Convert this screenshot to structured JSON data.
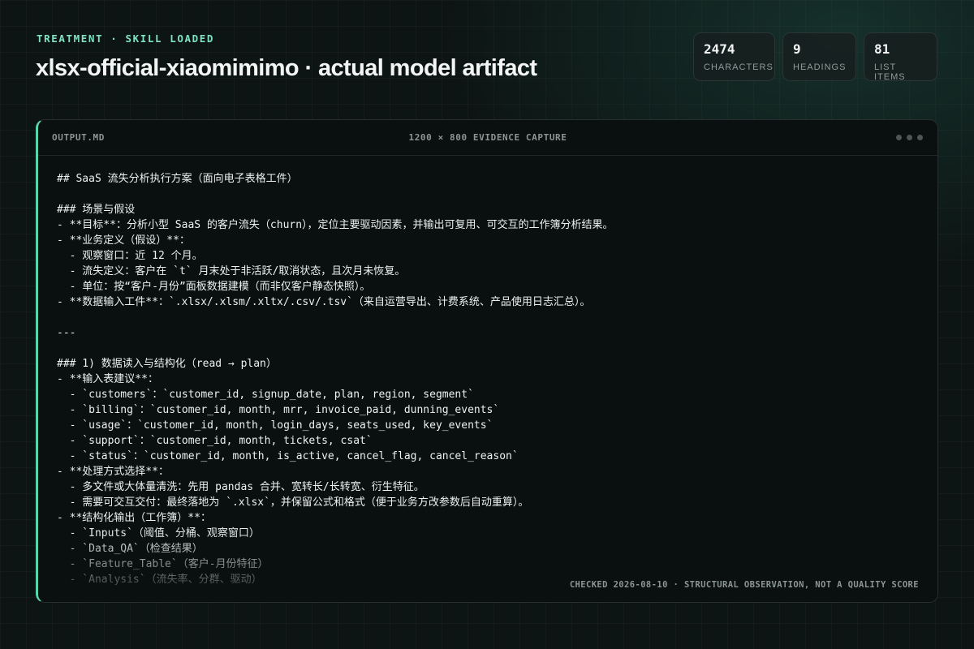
{
  "header": {
    "kicker": "TREATMENT · SKILL LOADED",
    "title": "xlsx-official-xiaomimimo · actual model artifact"
  },
  "stats": [
    {
      "value": "2474",
      "label": "CHARACTERS"
    },
    {
      "value": "9",
      "label": "HEADINGS"
    },
    {
      "value": "81",
      "label": "LIST ITEMS"
    }
  ],
  "panel": {
    "file_name": "OUTPUT.MD",
    "capture_label": "1200 × 800 EVIDENCE CAPTURE",
    "footnote": "CHECKED 2026-08-10 · STRUCTURAL OBSERVATION, NOT A QUALITY SCORE",
    "lines": [
      "## SaaS 流失分析执行方案（面向电子表格工件）",
      "",
      "### 场景与假设",
      "- **目标**：分析小型 SaaS 的客户流失（churn），定位主要驱动因素，并输出可复用、可交互的工作簿分析结果。",
      "- **业务定义（假设）**：",
      "  - 观察窗口：近 12 个月。",
      "  - 流失定义：客户在 `t` 月末处于非活跃/取消状态，且次月未恢复。",
      "  - 单位：按“客户-月份”面板数据建模（而非仅客户静态快照）。",
      "- **数据输入工件**：`.xlsx/.xlsm/.xltx/.csv/.tsv`（来自运营导出、计费系统、产品使用日志汇总）。",
      "",
      "---",
      "",
      "### 1) 数据读入与结构化（read → plan）",
      "- **输入表建议**：",
      "  - `customers`：`customer_id, signup_date, plan, region, segment`",
      "  - `billing`：`customer_id, month, mrr, invoice_paid, dunning_events`",
      "  - `usage`：`customer_id, month, login_days, seats_used, key_events`",
      "  - `support`：`customer_id, month, tickets, csat`",
      "  - `status`：`customer_id, month, is_active, cancel_flag, cancel_reason`",
      "- **处理方式选择**：",
      "  - 多文件或大体量清洗：先用 pandas 合并、宽转长/长转宽、衍生特征。",
      "  - 需要可交互交付：最终落地为 `.xlsx`，并保留公式和格式（便于业务方改参数后自动重算）。",
      "- **结构化输出（工作簿）**：",
      "  - `Inputs`（阈值、分桶、观察窗口）",
      "  - `Data_QA`（检查结果）",
      "  - `Feature_Table`（客户-月份特征）",
      "  - `Analysis`（流失率、分群、驱动）"
    ]
  }
}
